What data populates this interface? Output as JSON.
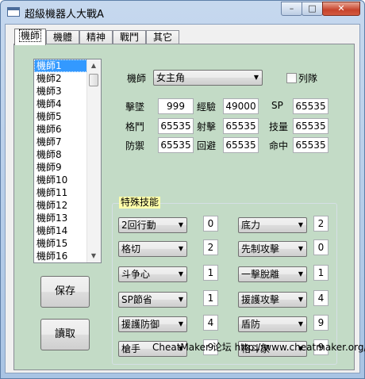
{
  "window": {
    "title": "超級機器人大戰A",
    "minimize_glyph": "–",
    "maximize_glyph": "□",
    "close_glyph": "✕"
  },
  "tabs": [
    {
      "label": "機師"
    },
    {
      "label": "機體"
    },
    {
      "label": "精神"
    },
    {
      "label": "戰鬥"
    },
    {
      "label": "其它"
    }
  ],
  "pilot_list": {
    "items": [
      "機師1",
      "機師2",
      "機師3",
      "機師4",
      "機師5",
      "機師6",
      "機師7",
      "機師8",
      "機師9",
      "機師10",
      "機師11",
      "機師12",
      "機師13",
      "機師14",
      "機師15",
      "機師16"
    ],
    "selected": "機師1"
  },
  "buttons": {
    "save": "保存",
    "read": "讀取"
  },
  "pilot": {
    "label": "機師",
    "selected": "女主角",
    "team_label": "列隊"
  },
  "stats": {
    "melee_label": "擊墜",
    "melee_value": "999",
    "exp_label": "經驗",
    "exp_value": "49000",
    "sp_label": "SP",
    "sp_value": "65535",
    "fight_label": "格鬥",
    "fight_value": "65535",
    "shoot_label": "射擊",
    "shoot_value": "65535",
    "skill_label": "技量",
    "skill_value": "65535",
    "defense_label": "防禦",
    "defense_value": "65535",
    "evade_label": "回避",
    "evade_value": "65535",
    "hit_label": "命中",
    "hit_value": "65535"
  },
  "special_skills": {
    "title": "特殊技能",
    "left": [
      {
        "name": "2回行動",
        "level": "0"
      },
      {
        "name": "格切",
        "level": "2"
      },
      {
        "name": "斗争心",
        "level": "1"
      },
      {
        "name": "SP節省",
        "level": "1"
      },
      {
        "name": "援護防御",
        "level": "4"
      },
      {
        "name": "槍手",
        "level": "9"
      }
    ],
    "right": [
      {
        "name": "底力",
        "level": "2"
      },
      {
        "name": "先制攻擊",
        "level": "0"
      },
      {
        "name": "一擊脫離",
        "level": "1"
      },
      {
        "name": "援護攻擊",
        "level": "4"
      },
      {
        "name": "盾防",
        "level": "9"
      },
      {
        "name": "格斗家",
        "level": "9"
      }
    ]
  },
  "footer": "CheatMaker 论坛 http://www.cheatmaker.org/"
}
